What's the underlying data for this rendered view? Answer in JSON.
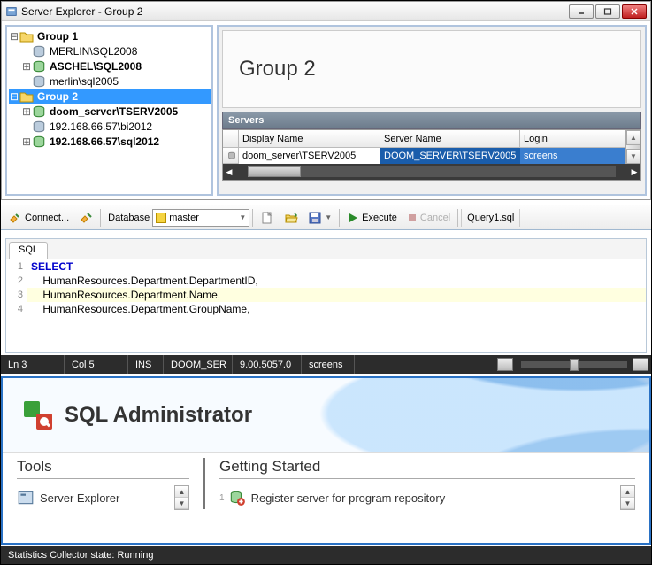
{
  "explorer": {
    "title": "Server Explorer - Group 2",
    "tree": {
      "group1": {
        "label": "Group 1"
      },
      "n1": {
        "label": "MERLIN\\SQL2008"
      },
      "n2": {
        "label": "ASCHEL\\SQL2008"
      },
      "n3": {
        "label": "merlin\\sql2005"
      },
      "group2": {
        "label": "Group 2"
      },
      "n4": {
        "label": "doom_server\\TSERV2005"
      },
      "n5": {
        "label": "192.168.66.57\\bi2012"
      },
      "n6": {
        "label": "192.168.66.57\\sql2012"
      }
    },
    "right": {
      "heading": "Group 2",
      "servers_label": "Servers",
      "columns": {
        "c1": "Display Name",
        "c2": "Server Name",
        "c3": "Login"
      },
      "row1": {
        "c1": "doom_server\\TSERV2005",
        "c2": "DOOM_SERVER\\TSERV2005",
        "c3": "screens"
      }
    }
  },
  "toolbar": {
    "connect": "Connect...",
    "database_label": "Database",
    "database_value": "master",
    "execute": "Execute",
    "cancel": "Cancel",
    "query_tab": "Query1.sql"
  },
  "editor": {
    "tab": "SQL",
    "lines": {
      "l1": "SELECT",
      "l2": "    HumanResources.Department.DepartmentID,",
      "l3": "    HumanResources.Department.Name,",
      "l4": "    HumanResources.Department.GroupName,"
    },
    "gutter": {
      "g1": "1",
      "g2": "2",
      "g3": "3",
      "g4": "4"
    }
  },
  "ed_status": {
    "ln": "Ln 3",
    "col": "Col 5",
    "ins": "INS",
    "server": "DOOM_SER",
    "ver": "9.00.5057.0",
    "user": "screens"
  },
  "welcome": {
    "product": "SQL Administrator",
    "tools_h": "Tools",
    "tools_item": "Server Explorer",
    "gs_h": "Getting Started",
    "gs_item": "Register server for program repository",
    "gs_num": "1"
  },
  "bottom_status": "Statistics Collector state: Running"
}
